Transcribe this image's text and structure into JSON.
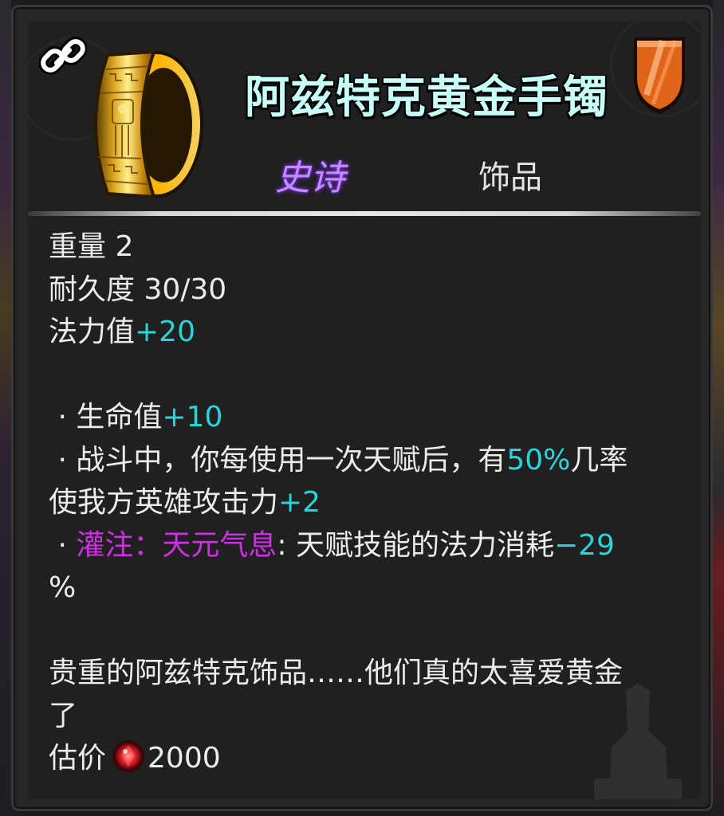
{
  "item": {
    "name": "阿兹特克黄金手镯",
    "rarity": "史诗",
    "category": "饰品"
  },
  "stats": {
    "weight_label": "重量 2",
    "durability_label": "耐久度 30/30",
    "mana_label": "法力值",
    "mana_value": "+20"
  },
  "effects": {
    "bullet": "·",
    "hp_label": "生命值",
    "hp_value": "+10",
    "effect2_pre": "战斗中，你每使用一次天赋后，有",
    "effect2_pct": "50%",
    "effect2_post": "几率",
    "effect2_line2_pre": "使我方英雄攻击力",
    "effect2_line2_value": "+2",
    "infuse_label": "灌注：天元气息",
    "infuse_colon": ": ",
    "infuse_desc": "天赋技能的法力消耗",
    "infuse_value": "−29",
    "infuse_line2": "%"
  },
  "flavor": {
    "line1": "贵重的阿兹特克饰品……他们真的太喜爱黄金",
    "line2": "了"
  },
  "price": {
    "label": "估价",
    "value": "2000",
    "icon": "red-gem-icon"
  },
  "colors": {
    "title": "#c9fff9",
    "rarity_epic": "#c58bff",
    "highlight": "#2ad5d9",
    "infuse": "#d22ee8"
  }
}
